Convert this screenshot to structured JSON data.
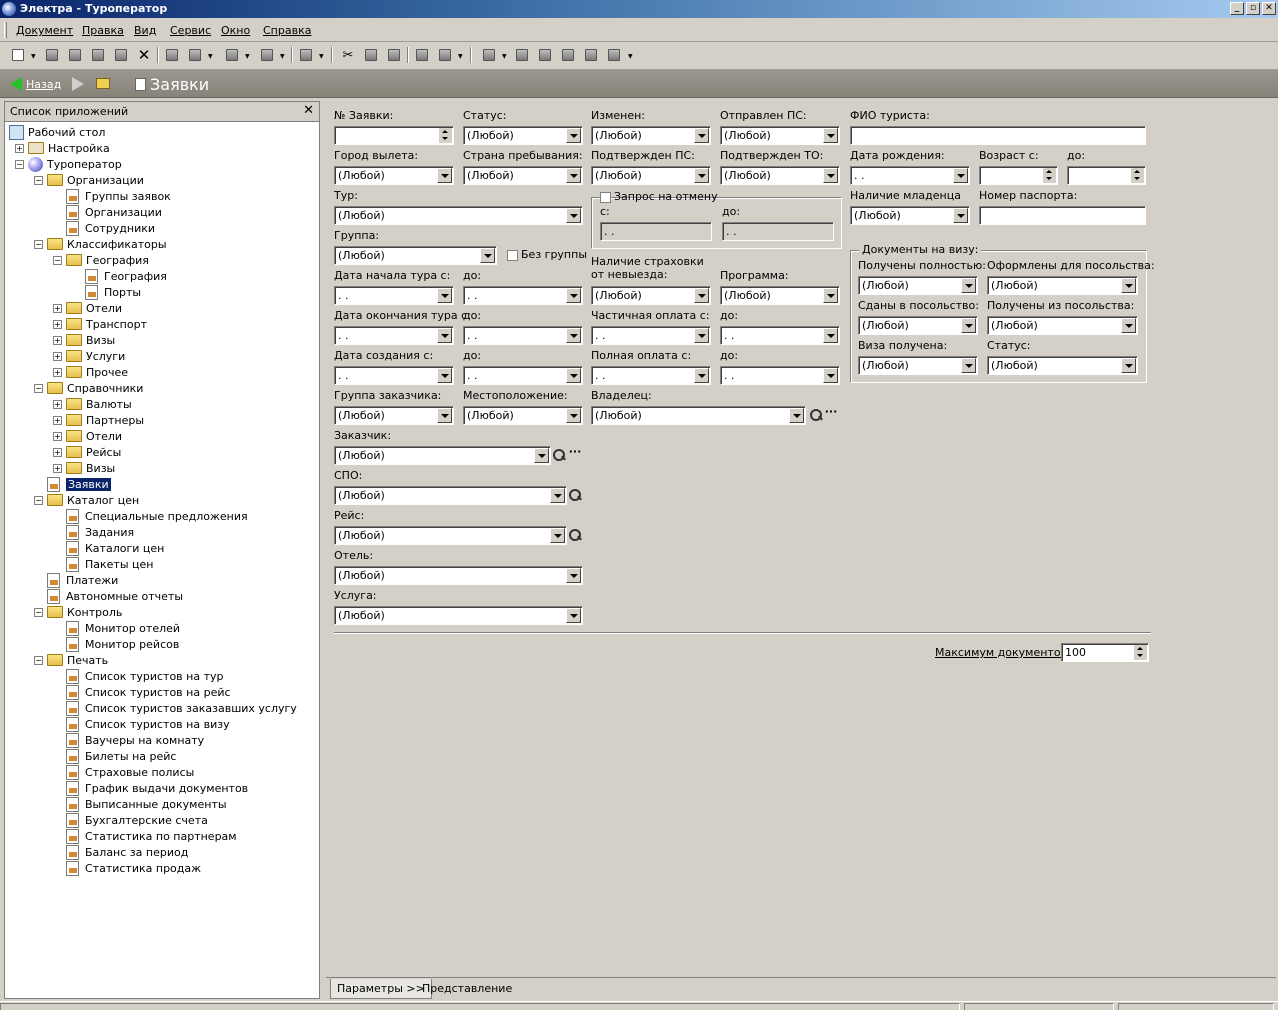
{
  "window": {
    "title": "Электра - Туроператор",
    "controls": [
      "_",
      "▫",
      "✕"
    ]
  },
  "menu": [
    "Документ",
    "Правка",
    "Вид",
    "Сервис",
    "Окно",
    "Справка"
  ],
  "nav": {
    "back_label": "Назад",
    "page_title": "Заявки"
  },
  "left_panel": {
    "title": "Список приложений",
    "tree": [
      "Рабочий стол",
      "Настройка",
      "Туроператор",
      "Организации",
      "Группы заявок",
      "Организации",
      "Сотрудники",
      "Классификаторы",
      "География",
      "География",
      "Порты",
      "Отели",
      "Транспорт",
      "Визы",
      "Услуги",
      "Прочее",
      "Справочники",
      "Валюты",
      "Партнеры",
      "Отели",
      "Рейсы",
      "Визы",
      "Заявки",
      "Каталог цен",
      "Специальные предложения",
      "Задания",
      "Каталоги цен",
      "Пакеты цен",
      "Платежи",
      "Автономные отчеты",
      "Контроль",
      "Монитор отелей",
      "Монитор рейсов",
      "Печать",
      "Список туристов на тур",
      "Список туристов на рейс",
      "Список туристов заказавших услугу",
      "Список туристов на визу",
      "Ваучеры на комнату",
      "Билеты на рейс",
      "Страховые полисы",
      "График выдачи документов",
      "Выписанные документы",
      "Бухгалтерские счета",
      "Статистика по партнерам",
      "Баланс за период",
      "Статистика продаж"
    ]
  },
  "form": {
    "any": "(Любой)",
    "date_empty": " .  .",
    "labels": {
      "num": "№ Заявки:",
      "status": "Статус:",
      "changed": "Изменен:",
      "sent_ps": "Отправлен ПС:",
      "fio": "ФИО туриста:",
      "city": "Город вылета:",
      "country": "Страна пребывания:",
      "conf_ps": "Подтвержден ПС:",
      "conf_to": "Подтвержден ТО:",
      "birth": "Дата рождения:",
      "age_from": "Возраст с:",
      "to": "до:",
      "tour": "Тур:",
      "cancel_req": "Запрос на отмену",
      "from": "с:",
      "infant": "Наличие младенца",
      "passport": "Номер паспорта:",
      "group": "Группа:",
      "no_group": "Без группы",
      "tour_start": "Дата начала тура с:",
      "insurance": "Наличие страховки от невыезда:",
      "program": "Программа:",
      "tour_end": "Дата окончания тура с:",
      "partial": "Частичная оплата с:",
      "created": "Дата создания с:",
      "full": "Полная оплата с:",
      "cust_group": "Группа заказчика:",
      "location": "Местоположение:",
      "owner": "Владелец:",
      "customer": "Заказчик:",
      "spo": "СПО:",
      "flight": "Рейс:",
      "hotel": "Отель:",
      "service": "Услуга:",
      "visa_docs": "Документы на визу:",
      "received_full": "Получены полностью:",
      "prepared": "Оформлены для посольства:",
      "submitted": "Сданы в посольство:",
      "received_emb": "Получены из посольства:",
      "visa_got": "Виза получена:",
      "visa_status": "Статус:",
      "max_docs": "Максимум документов:"
    },
    "max_docs_value": "100"
  },
  "tabs": [
    "Параметры >>",
    "Представление"
  ]
}
